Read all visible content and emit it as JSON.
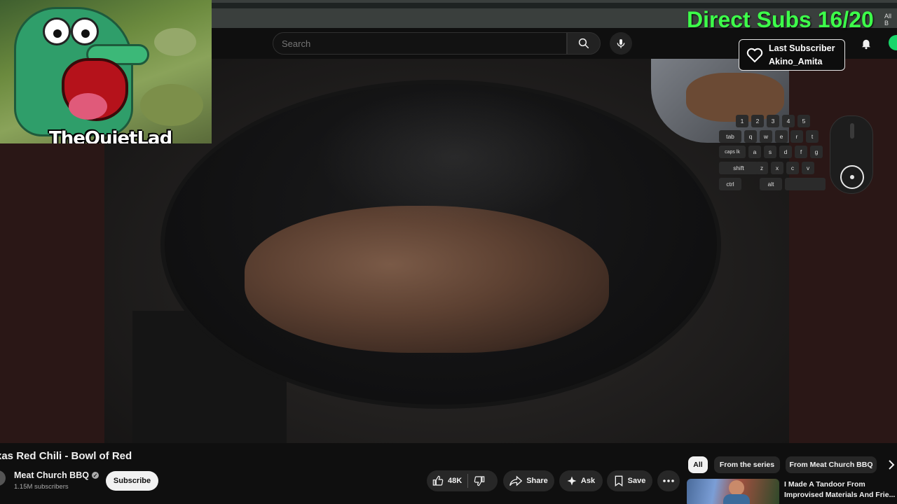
{
  "search": {
    "placeholder": "Search"
  },
  "overlay": {
    "streamer_name": "TheQuietLad",
    "direct_subs": "Direct Subs 16/20",
    "all_label": "All B",
    "last_subscriber_label": "Last Subscriber",
    "last_subscriber_name": "Akino_Amita"
  },
  "keyboard": {
    "row1": [
      "1",
      "2",
      "3",
      "4",
      "5"
    ],
    "row2": [
      "tab",
      "q",
      "w",
      "e",
      "r",
      "t"
    ],
    "row3": [
      "caps lk",
      "a",
      "s",
      "d",
      "f",
      "g"
    ],
    "row4": [
      "shift",
      "z",
      "x",
      "c",
      "v"
    ],
    "row5": [
      "ctrl",
      "alt",
      ""
    ]
  },
  "video": {
    "title": "xas Red Chili - Bowl of Red",
    "channel": "Meat Church BBQ",
    "subscribers": "1.15M subscribers",
    "subscribe_label": "Subscribe",
    "likes": "48K",
    "share_label": "Share",
    "ask_label": "Ask",
    "save_label": "Save"
  },
  "chips": [
    "All",
    "From the series",
    "From Meat Church BBQ"
  ],
  "recommendation": {
    "title": "I Made A Tandoor From Improvised Materials And Frie..."
  },
  "colors": {
    "subs_green": "#3dff4a",
    "bg": "#0f0f0f",
    "pill": "#272727"
  }
}
